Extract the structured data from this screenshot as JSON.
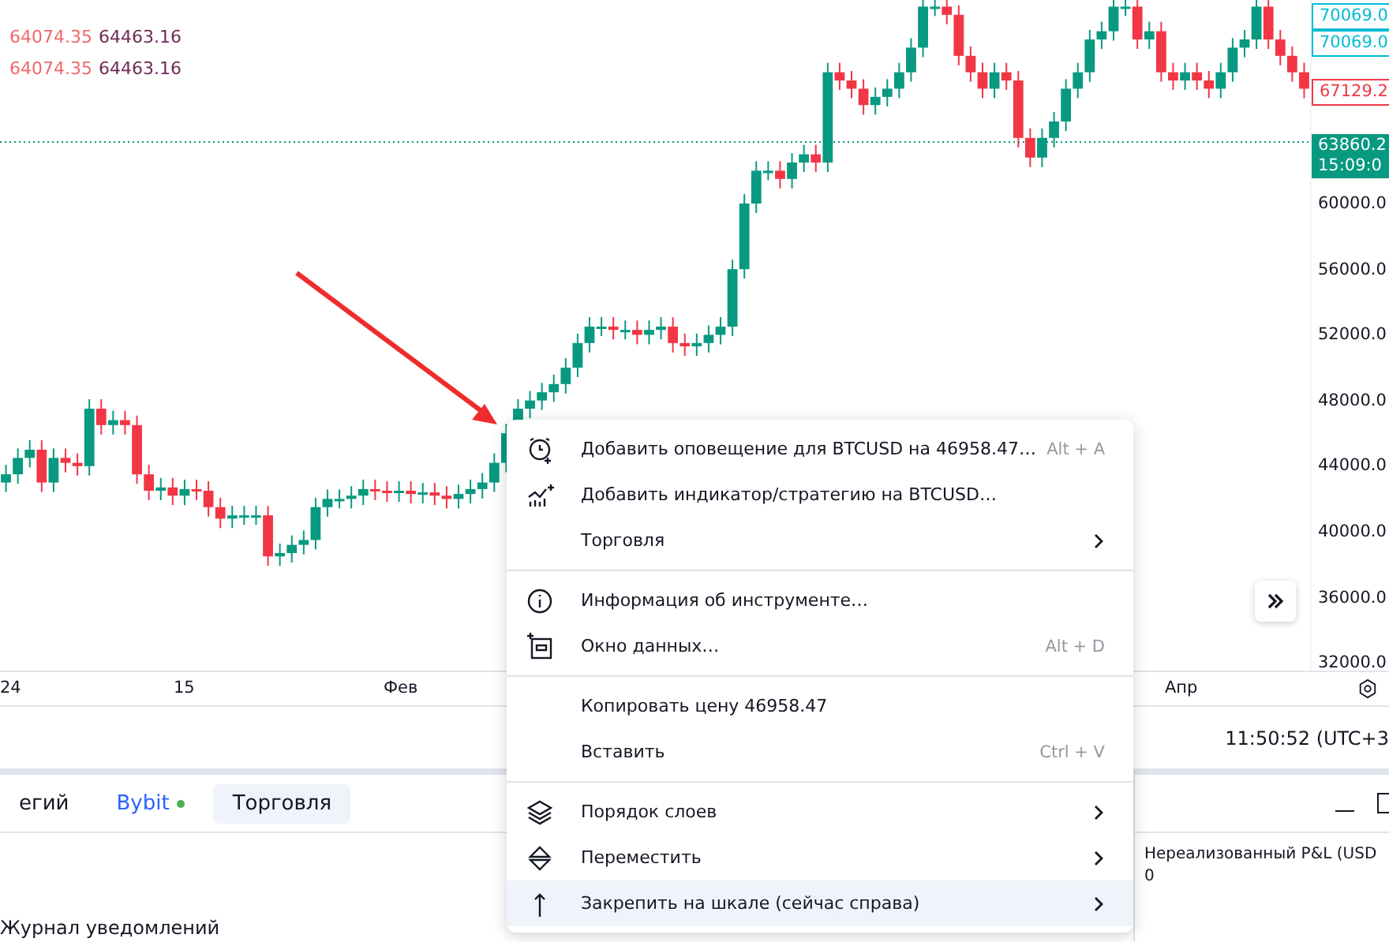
{
  "legend": [
    {
      "open": "64074.35",
      "close": "64463.16"
    },
    {
      "open": "64074.35",
      "close": "64463.16"
    }
  ],
  "price_axis": {
    "badges": [
      {
        "kind": "alert",
        "lines": [
          "70069.0"
        ]
      },
      {
        "kind": "alert",
        "lines": [
          "70069.0"
        ]
      },
      {
        "kind": "order",
        "lines": [
          "67129.2"
        ]
      },
      {
        "kind": "last",
        "lines": [
          "63860.2",
          "15:09:0"
        ]
      }
    ],
    "ticks": [
      "60000.0",
      "56000.0",
      "52000.0",
      "48000.0",
      "44000.0",
      "40000.0",
      "36000.0",
      "32000.0"
    ]
  },
  "time_axis": [
    "24",
    "15",
    "Фев",
    "Апр"
  ],
  "status": {
    "time": "11:50:52 (UTC+3"
  },
  "bottom_tabs": [
    {
      "label": "егий",
      "selected": false
    },
    {
      "label": "Bybit",
      "selected": false,
      "color": "#4caf50"
    },
    {
      "label": "Торговля",
      "selected": true
    }
  ],
  "notifications": {
    "label": "Журнал уведомлений"
  },
  "account": {
    "label": "Нереализованный P&L (USD",
    "value": "0"
  },
  "context_menu": [
    [
      {
        "label": "Добавить оповещение для BTCUSD на 46958.47…",
        "shortcut": "Alt + A",
        "submenu": false,
        "selected": false
      },
      {
        "label": "Добавить индикатор/стратегию на BTCUSD…",
        "submenu": false,
        "selected": false
      },
      {
        "label": "Торговля",
        "submenu": true,
        "selected": false
      }
    ],
    [
      {
        "label": "Информация об инструменте…",
        "submenu": false,
        "selected": false
      },
      {
        "label": "Окно данных…",
        "shortcut": "Alt + D",
        "submenu": false,
        "selected": false
      }
    ],
    [
      {
        "label": "Копировать цену 46958.47",
        "submenu": false,
        "selected": false
      },
      {
        "label": "Вставить",
        "shortcut": "Ctrl + V",
        "submenu": false,
        "selected": false
      }
    ],
    [
      {
        "label": "Порядок слоев",
        "submenu": true,
        "selected": false
      },
      {
        "label": "Переместить",
        "submenu": true,
        "selected": false
      },
      {
        "label": "Закрепить на шкале (сейчас справа)",
        "submenu": true,
        "selected": true
      }
    ]
  ]
}
